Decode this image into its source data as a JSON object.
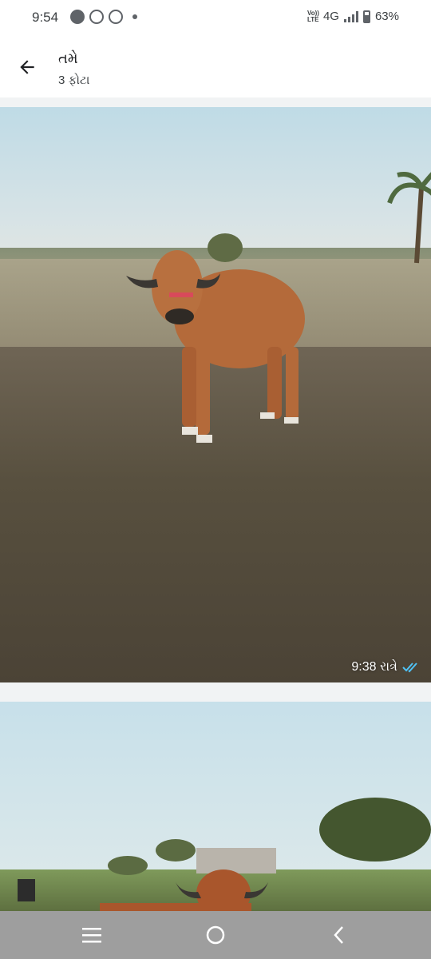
{
  "status_bar": {
    "time": "9:54",
    "network_label": "Vo)) LTE",
    "network_type": "4G",
    "battery": "63%",
    "left_icons": [
      "sync-icon",
      "whatsapp-icon",
      "screen-record-icon",
      "dot-icon"
    ]
  },
  "app_bar": {
    "title": "તમે",
    "subtitle": "3 ફોટા",
    "back_icon": "arrow-left-icon"
  },
  "photos": [
    {
      "timestamp": "9:38 રાત્રે",
      "status_icon": "double-check-icon",
      "status_color": "#4fc3f7"
    },
    {
      "timestamp": ""
    }
  ],
  "nav_bar": {
    "buttons": [
      "recent-apps-icon",
      "home-icon",
      "back-icon"
    ]
  }
}
